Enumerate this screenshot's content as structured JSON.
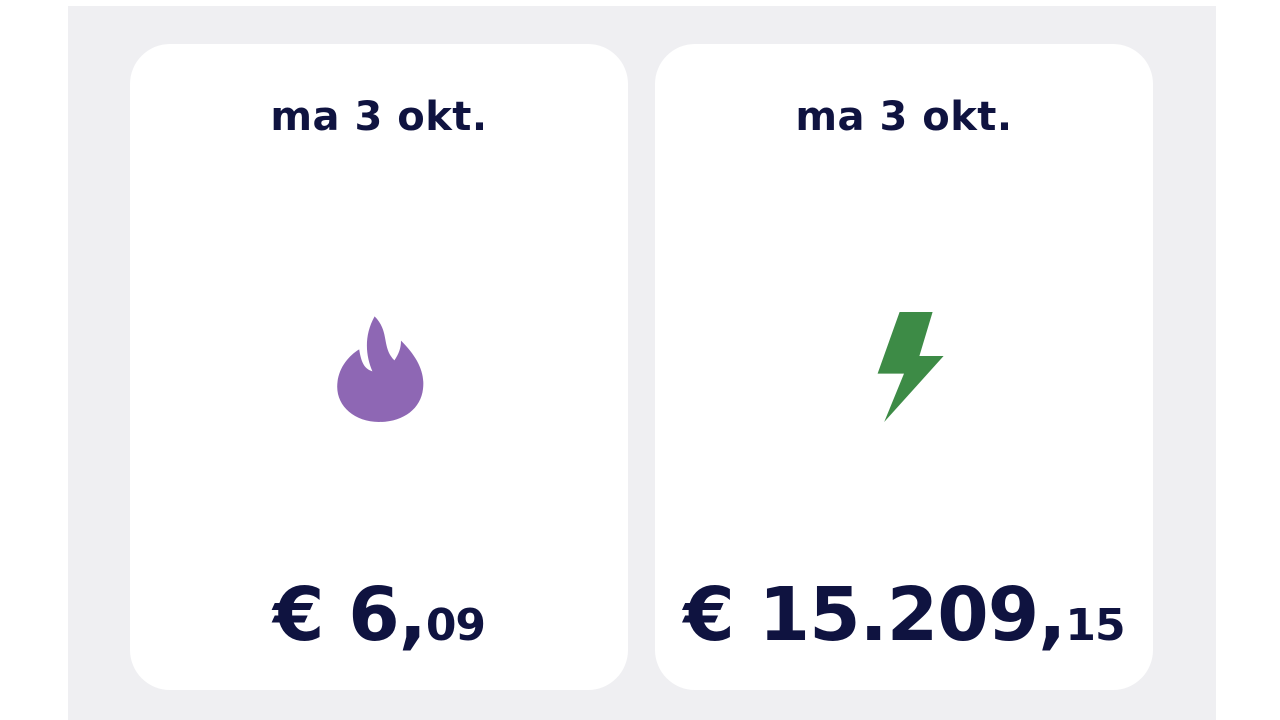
{
  "cards": [
    {
      "date": "ma 3 okt.",
      "icon": "flame-icon",
      "icon_color": "#8e67b4",
      "amount_main": "€ 6,",
      "amount_cents": "09"
    },
    {
      "date": "ma 3 okt.",
      "icon": "lightning-bolt-icon",
      "icon_color": "#3d8b46",
      "amount_main": "€ 15.209,",
      "amount_cents": "15"
    }
  ],
  "colors": {
    "background": "#efeff2",
    "card": "#ffffff",
    "text": "#0f1340"
  }
}
